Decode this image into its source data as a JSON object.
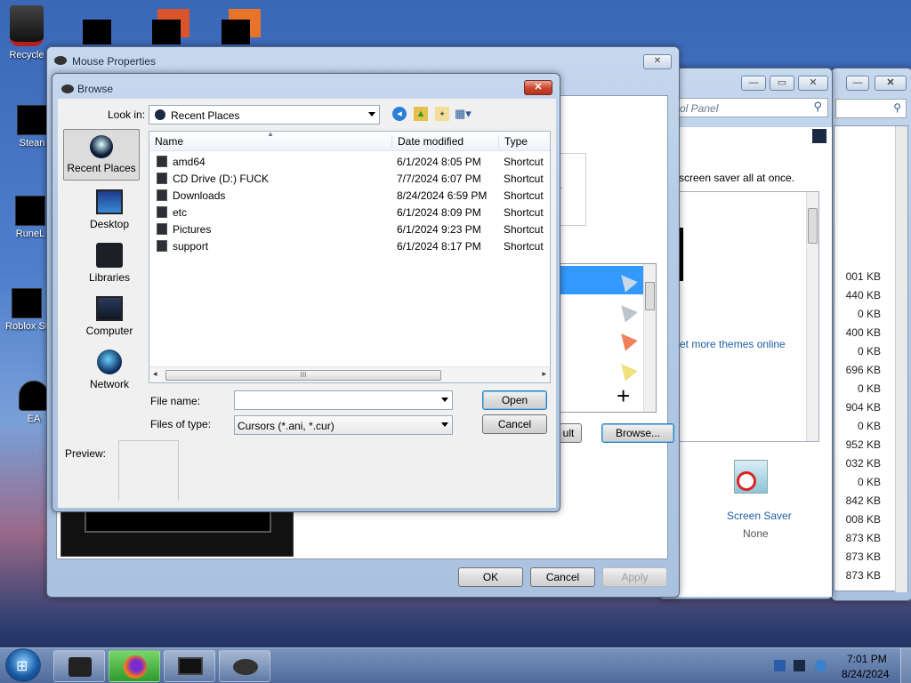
{
  "desktop": {
    "icons": [
      "Recycle",
      "Stean",
      "RuneL",
      "Roblox St",
      "EA"
    ]
  },
  "control_panel": {
    "search_placeholder": "ol Panel",
    "screensaver_text": "screen saver all at once.",
    "more_themes_link": "et more themes online",
    "screen_saver_label": "Screen Saver",
    "screen_saver_value": "None"
  },
  "explorer_sizes": [
    "001 KB",
    "440 KB",
    "0 KB",
    "400 KB",
    "0 KB",
    "696 KB",
    "0 KB",
    "904 KB",
    "0 KB",
    "952 KB",
    "032 KB",
    "0 KB",
    "842 KB",
    "008 KB",
    "873 KB",
    "873 KB",
    "873 KB"
  ],
  "mouse_properties": {
    "title": "Mouse Properties",
    "default_button": "ult",
    "browse_button": "Browse...",
    "ok_button": "OK",
    "cancel_button": "Cancel",
    "apply_button": "Apply"
  },
  "browse_dialog": {
    "title": "Browse",
    "look_in_label": "Look in:",
    "look_in_value": "Recent Places",
    "places": [
      "Recent Places",
      "Desktop",
      "Libraries",
      "Computer",
      "Network"
    ],
    "columns": [
      "Name",
      "Date modified",
      "Type"
    ],
    "files": [
      {
        "name": "amd64",
        "date": "6/1/2024 8:05 PM",
        "type": "Shortcut"
      },
      {
        "name": "CD Drive (D:) FUCK",
        "date": "7/7/2024 6:07 PM",
        "type": "Shortcut"
      },
      {
        "name": "Downloads",
        "date": "8/24/2024 6:59 PM",
        "type": "Shortcut"
      },
      {
        "name": "etc",
        "date": "6/1/2024 8:09 PM",
        "type": "Shortcut"
      },
      {
        "name": "Pictures",
        "date": "6/1/2024 9:23 PM",
        "type": "Shortcut"
      },
      {
        "name": "support",
        "date": "6/1/2024 8:17 PM",
        "type": "Shortcut"
      }
    ],
    "file_name_label": "File name:",
    "file_name_value": "",
    "files_of_type_label": "Files of type:",
    "files_of_type_value": "Cursors (*.ani, *.cur)",
    "open_button": "Open",
    "cancel_button": "Cancel",
    "preview_label": "Preview:",
    "scroll_grip": "III"
  },
  "taskbar": {
    "time": "7:01 PM",
    "date": "8/24/2024"
  },
  "colors": {
    "selection": "#3399ff",
    "link": "#1f5fa8",
    "close_red": "#c8452e"
  }
}
